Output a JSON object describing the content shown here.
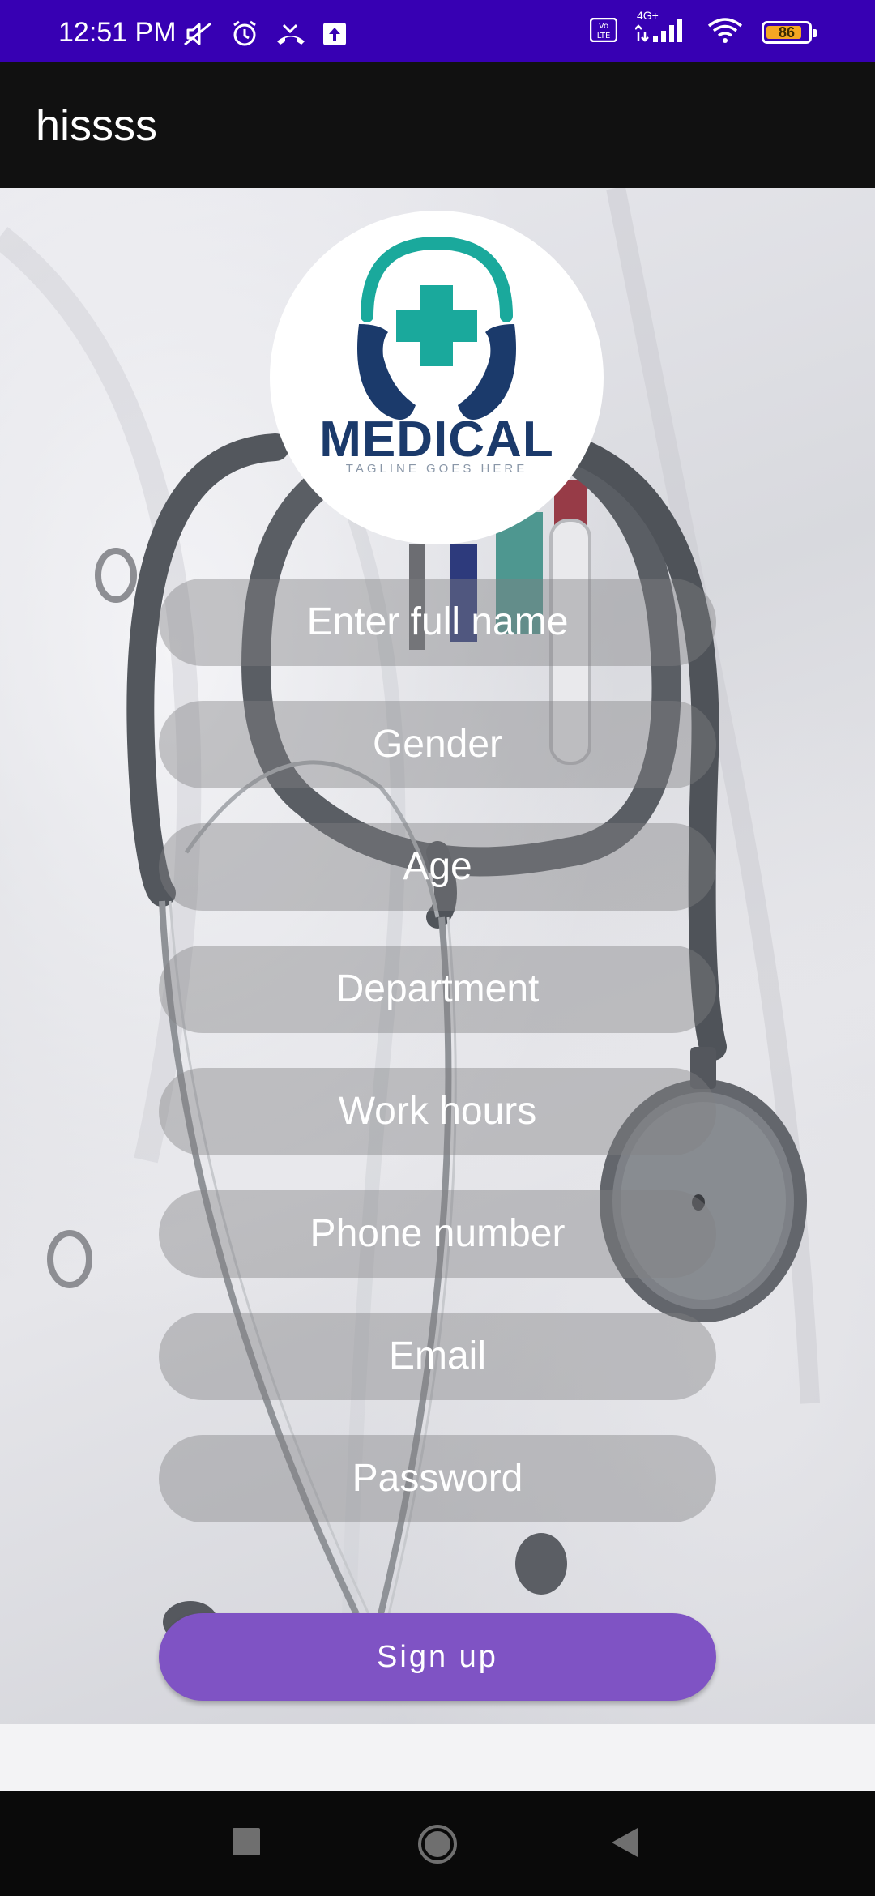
{
  "status_bar": {
    "time": "12:51 PM",
    "network_label": "4G+",
    "battery_level": "86",
    "battery_fraction": 0.86,
    "icons": [
      "mute-icon",
      "alarm-icon",
      "missed-call-icon",
      "upload-icon",
      "volte-icon",
      "signal-icon",
      "wifi-icon",
      "battery-icon"
    ]
  },
  "app_bar": {
    "title": "hissss"
  },
  "logo": {
    "wordmark": "MEDICAL",
    "tagline": "TAGLINE GOES HERE",
    "colors": {
      "teal": "#1aa99c",
      "navy": "#1b3a6b"
    }
  },
  "form": {
    "fields": [
      {
        "placeholder": "Enter full name"
      },
      {
        "placeholder": "Gender"
      },
      {
        "placeholder": "Age"
      },
      {
        "placeholder": "Department"
      },
      {
        "placeholder": "Work hours"
      },
      {
        "placeholder": "Phone number"
      },
      {
        "placeholder": "Email"
      },
      {
        "placeholder": "Password"
      }
    ],
    "submit_label": "Sign up"
  },
  "colors": {
    "status_bar": "#3700b3",
    "app_bar": "#111111",
    "accent": "#7f53c4"
  },
  "nav_bar": {
    "buttons": [
      "recents-icon",
      "home-icon",
      "back-icon"
    ]
  }
}
